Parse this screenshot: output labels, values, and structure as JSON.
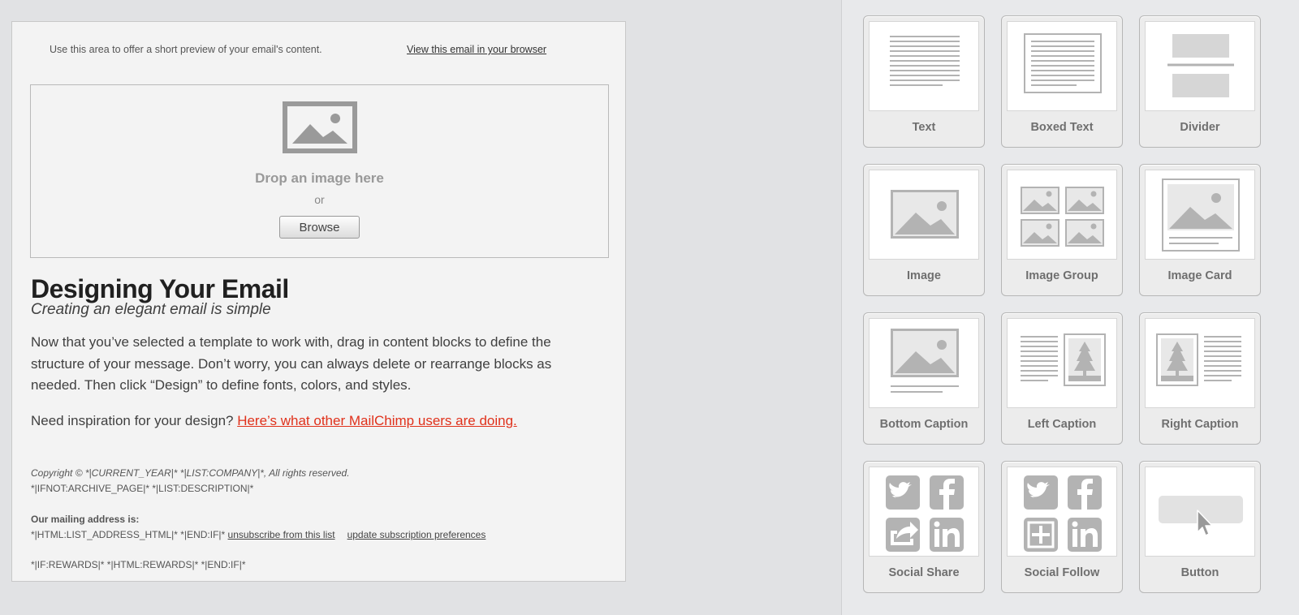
{
  "email": {
    "preheader_text": "Use this area to offer a short preview of your email's content.",
    "view_in_browser": "View this email in your browser",
    "image_drop": {
      "prompt": "Drop an image here",
      "or": "or",
      "browse_label": "Browse"
    },
    "headline": "Designing Your Email",
    "subheadline": "Creating an elegant email is simple",
    "body": "Now that you’ve selected a template to work with, drag in content blocks to define the structure of your message. Don’t worry, you can always delete or rearrange blocks as needed. Then click “Design” to define fonts, colors, and styles.",
    "inspiration_text": "Need inspiration for your design? ",
    "inspiration_link": "Here’s what other MailChimp users are doing.",
    "footer": {
      "copyright": "Copyright © *|CURRENT_YEAR|* *|LIST:COMPANY|*, All rights reserved.",
      "ifnot": "*|IFNOT:ARCHIVE_PAGE|* *|LIST:DESCRIPTION|*",
      "mailing_heading": "Our mailing address is:",
      "address_tags": "*|HTML:LIST_ADDRESS_HTML|* *|END:IF|* ",
      "unsubscribe": "unsubscribe from this list",
      "update_prefs": "update subscription preferences",
      "rewards": "*|IF:REWARDS|* *|HTML:REWARDS|* *|END:IF|*"
    }
  },
  "blocks": [
    {
      "label": "Text",
      "icon": "text-block-icon"
    },
    {
      "label": "Boxed Text",
      "icon": "boxed-text-block-icon"
    },
    {
      "label": "Divider",
      "icon": "divider-block-icon"
    },
    {
      "label": "Image",
      "icon": "image-block-icon"
    },
    {
      "label": "Image Group",
      "icon": "image-group-block-icon"
    },
    {
      "label": "Image Card",
      "icon": "image-card-block-icon"
    },
    {
      "label": "Bottom Caption",
      "icon": "bottom-caption-block-icon"
    },
    {
      "label": "Left Caption",
      "icon": "left-caption-block-icon"
    },
    {
      "label": "Right Caption",
      "icon": "right-caption-block-icon"
    },
    {
      "label": "Social Share",
      "icon": "social-share-block-icon"
    },
    {
      "label": "Social Follow",
      "icon": "social-follow-block-icon"
    },
    {
      "label": "Button",
      "icon": "button-block-icon"
    }
  ],
  "colors": {
    "link_red": "#e0311b",
    "icon_gray": "#b3b3b3",
    "block_label": "#6f6f6f"
  }
}
